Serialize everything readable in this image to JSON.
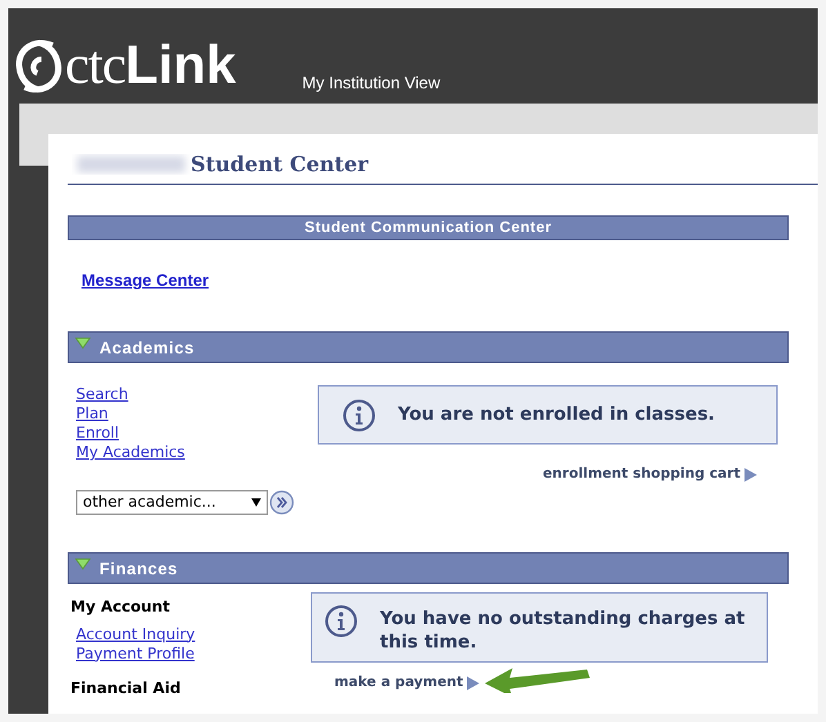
{
  "header": {
    "logo_light": "ctc",
    "logo_bold": "Link",
    "view_label": "My Institution View"
  },
  "page_title": "Student Center",
  "communication": {
    "title": "Student Communication Center",
    "link": "Message Center"
  },
  "academics": {
    "title": "Academics",
    "expanded": true,
    "links": [
      "Search",
      "Plan",
      "Enroll",
      "My Academics"
    ],
    "message": "You are not enrolled in classes.",
    "cart_link": "enrollment shopping cart",
    "select": {
      "value": "other academic..."
    }
  },
  "finances": {
    "title": "Finances",
    "expanded": true,
    "groups": [
      {
        "heading": "My Account",
        "links": [
          "Account Inquiry",
          "Payment Profile"
        ]
      },
      {
        "heading": "Financial Aid"
      }
    ],
    "message": "You have no outstanding charges at this time.",
    "payment_link": "make a payment"
  }
}
